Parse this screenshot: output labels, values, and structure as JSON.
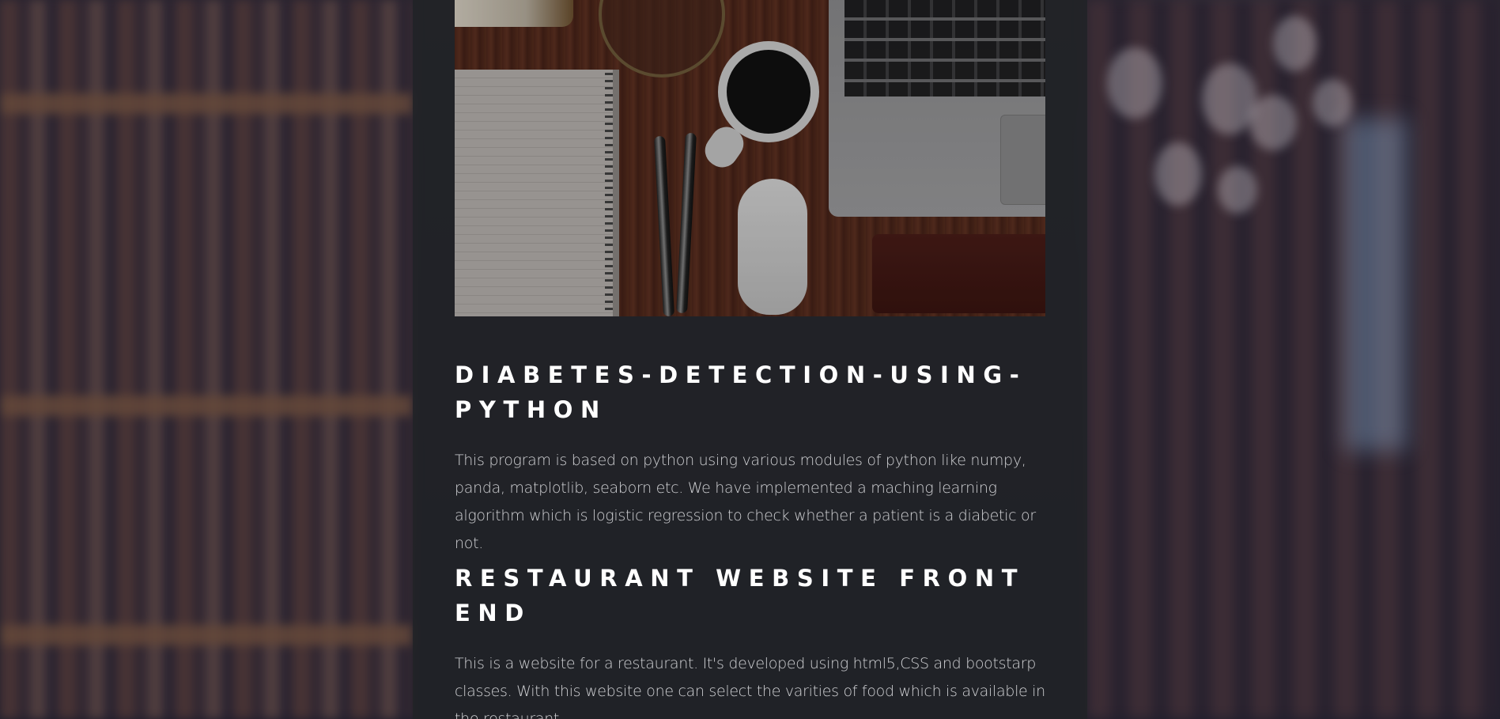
{
  "projects": [
    {
      "title": "DIABETES-DETECTION-USING-PYTHON",
      "description": "This program is based on python using various modules of python like numpy, panda, matplotlib, seaborn etc. We have implemented a maching learning algorithm which is logistic regression to check whether a patient is a diabetic or not."
    },
    {
      "title": "RESTAURANT WEBSITE FRONT END",
      "description": "This is a website for a restaurant. It's developed using html5,CSS and bootstarp classes. With this website one can select the varities of food which is available in the restaurant."
    }
  ],
  "colors": {
    "column_bg": "#212326",
    "heading": "#ffffff",
    "body_text": "#d0d1d4"
  }
}
